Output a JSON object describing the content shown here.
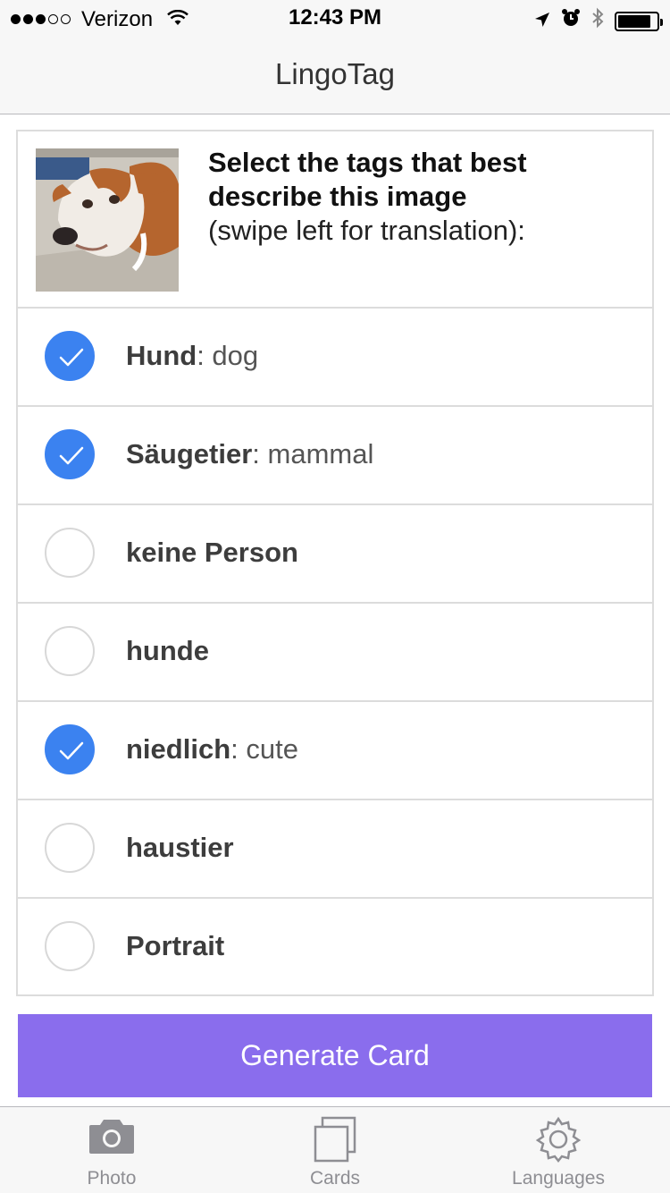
{
  "status_bar": {
    "carrier": "Verizon",
    "time": "12:43 PM",
    "signal_filled": 3,
    "signal_total": 5,
    "battery_level": 0.85
  },
  "nav": {
    "title": "LingoTag"
  },
  "prompt": {
    "title": "Select the tags that best describe this image",
    "hint": "(swipe left for translation):"
  },
  "tags": [
    {
      "word": "Hund",
      "translation": ": dog",
      "checked": true
    },
    {
      "word": "Säugetier",
      "translation": ": mammal",
      "checked": true
    },
    {
      "word": "keine Person",
      "translation": "",
      "checked": false
    },
    {
      "word": "hunde",
      "translation": "",
      "checked": false
    },
    {
      "word": "niedlich",
      "translation": ": cute",
      "checked": true
    },
    {
      "word": "haustier",
      "translation": "",
      "checked": false
    },
    {
      "word": "Portrait",
      "translation": "",
      "checked": false
    }
  ],
  "button": {
    "label": "Generate Card"
  },
  "tabbar": {
    "photo": {
      "label": "Photo",
      "icon": "camera-icon"
    },
    "cards": {
      "label": "Cards",
      "icon": "cards-icon"
    },
    "languages": {
      "label": "Languages",
      "icon": "gear-icon"
    }
  },
  "colors": {
    "accent": "#8a6ded",
    "check_on": "#3b82f0",
    "tab_inactive": "#8e8e93"
  }
}
